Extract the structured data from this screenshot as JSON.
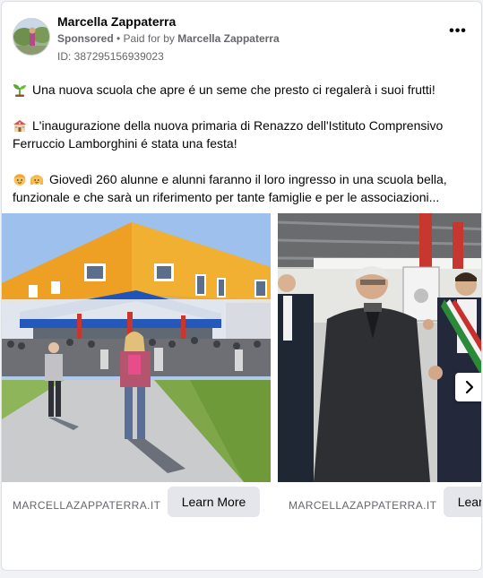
{
  "post": {
    "page_name": "Marcella Zappaterra",
    "sponsored_label": "Sponsored",
    "separator": " • ",
    "paid_for_prefix": "Paid for by ",
    "paid_for_name": "Marcella Zappaterra",
    "ad_id": "ID: 387295156939023",
    "more_icon": "more-icon",
    "paragraphs": [
      "Una nuova scuola che apre é un seme che presto ci regalerà i suoi frutti!",
      "L'inaugurazione della nuova primaria di Renazzo dell'Istituto Comprensivo Ferruccio Lamborghini é stata una festa!",
      "Giovedì 260 alunne e alunni faranno il loro ingresso in una scuola bella, funzionale e che sarà un riferimento per tante famiglie e per le associazioni..."
    ]
  },
  "carousel": {
    "cards": [
      {
        "domain": "MARCELLAZAPPATERRA.IT",
        "cta": "Learn More"
      },
      {
        "domain": "MARCELLAZAPPATERRA.IT",
        "cta": "Learn More"
      }
    ],
    "next_icon": "chevron-right-icon"
  }
}
